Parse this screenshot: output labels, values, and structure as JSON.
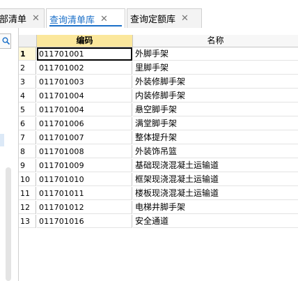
{
  "tabs": [
    {
      "label": "部清单",
      "close": "✕",
      "active": false
    },
    {
      "label": "查询清单库",
      "close": "✕",
      "active": true
    },
    {
      "label": "查询定额库",
      "close": "✕",
      "active": false
    }
  ],
  "left_panel": {
    "search_icon": "search-icon"
  },
  "table": {
    "headers": {
      "code": "编码",
      "name": "名称"
    },
    "rows": [
      {
        "num": "1",
        "code": "011701001",
        "name": "外脚手架"
      },
      {
        "num": "2",
        "code": "011701002",
        "name": "里脚手架"
      },
      {
        "num": "3",
        "code": "011701003",
        "name": "外装修脚手架"
      },
      {
        "num": "4",
        "code": "011701004",
        "name": "内装修脚手架"
      },
      {
        "num": "5",
        "code": "011701004",
        "name": "悬空脚手架"
      },
      {
        "num": "6",
        "code": "011701006",
        "name": "满堂脚手架"
      },
      {
        "num": "7",
        "code": "011701007",
        "name": "整体提升架"
      },
      {
        "num": "8",
        "code": "011701008",
        "name": "外装饰吊篮"
      },
      {
        "num": "9",
        "code": "011701009",
        "name": "基础现浇混凝土运输道"
      },
      {
        "num": "10",
        "code": "011701010",
        "name": "框架现浇混凝土运输道"
      },
      {
        "num": "11",
        "code": "011701011",
        "name": "楼板现浇混凝土运输道"
      },
      {
        "num": "12",
        "code": "011701012",
        "name": "电梯井脚手架"
      },
      {
        "num": "13",
        "code": "011701016",
        "name": "安全通道"
      }
    ]
  },
  "colors": {
    "accent": "#1a6fc8",
    "header_highlight": "#fbe79c"
  }
}
